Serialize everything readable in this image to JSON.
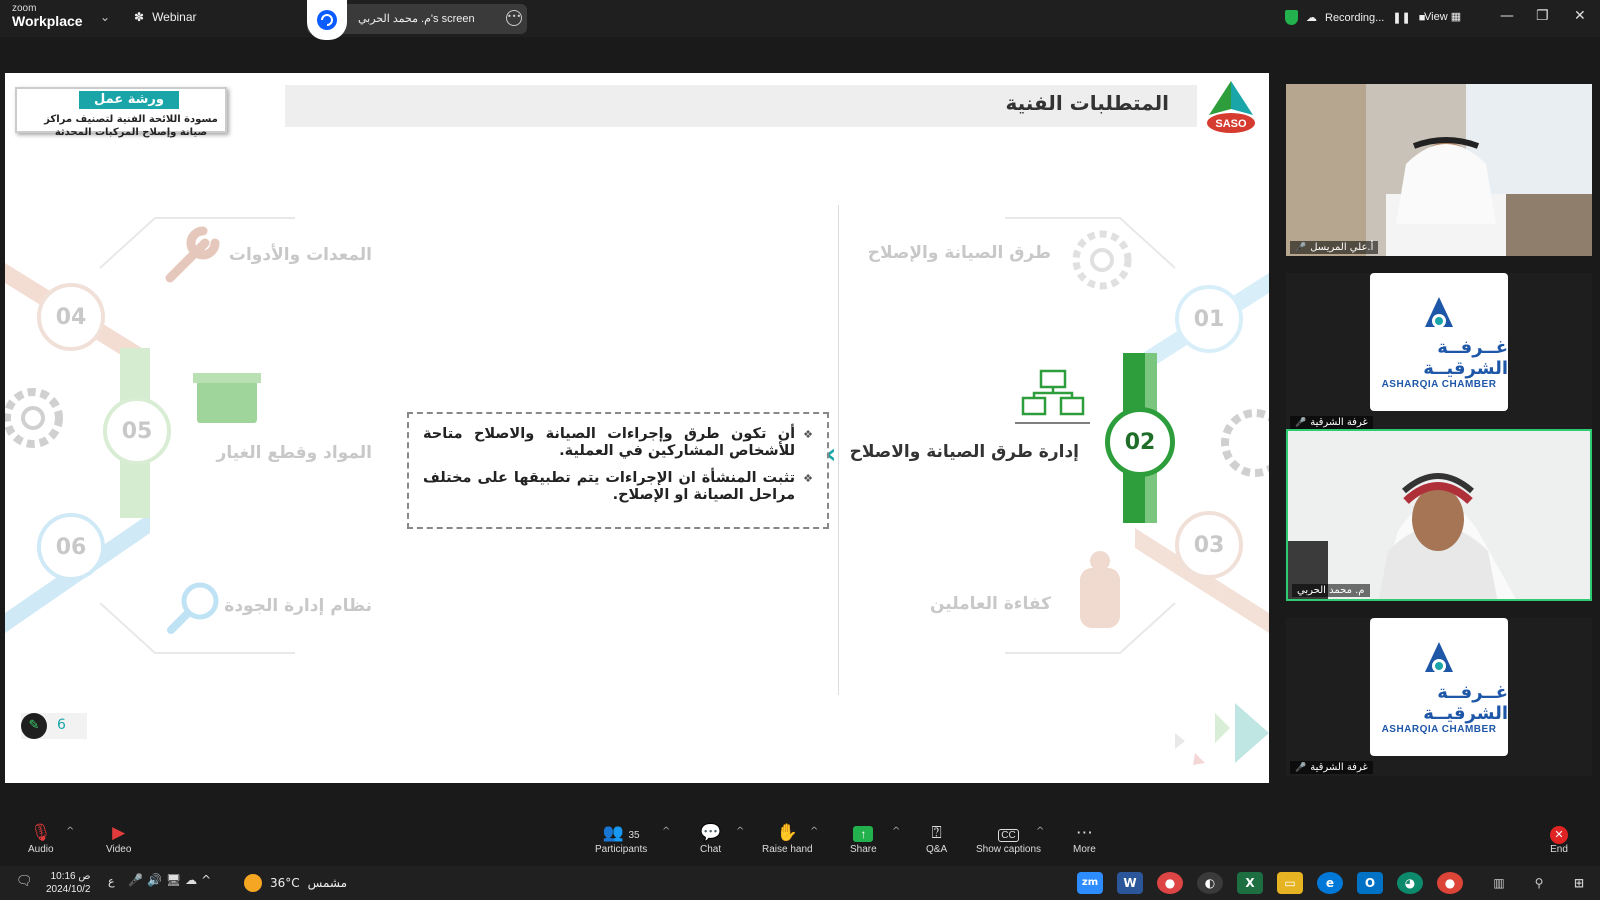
{
  "window": {
    "brand_small": "zoom",
    "brand_big": "Workplace",
    "mode_label": "Webinar",
    "share_label": "م. محمد الحربي's screen",
    "recording_label": "Recording...",
    "view_label": "View"
  },
  "slide": {
    "workshop_tag": "ورشة عمل",
    "workshop_text": "مسودة اللائحة الفنية لتصنيف مراكز صيانة وإصلاح المركبات المحدثة",
    "title": "المتطلبات الفنية",
    "logo_text": "SASO",
    "items": [
      {
        "num": "01",
        "label": "طرق الصيانة والإصلاح"
      },
      {
        "num": "02",
        "label": "إدارة طرق الصيانة والاصلاح"
      },
      {
        "num": "03",
        "label": "كفاءة العاملين"
      },
      {
        "num": "04",
        "label": "المعدات والأدوات"
      },
      {
        "num": "05",
        "label": "المواد وقطع الغيار"
      },
      {
        "num": "06",
        "label": "نظام إدارة الجودة"
      }
    ],
    "bullets": [
      "أن تكون طرق وإجراءات الصيانة والاصلاح متاحة للأشخاص المشاركين في العملية.",
      "تثبت المنشأة ان الإجراءات يتم تطبيقها على مختلف مراحل الصيانة او الإصلاح."
    ],
    "page_number": "6"
  },
  "participants": [
    {
      "name": "أ.علي المريسل",
      "type": "video"
    },
    {
      "name": "غرفة الشرقية",
      "type": "logo"
    },
    {
      "name": "م. محمد الحربي",
      "type": "video",
      "active": true
    },
    {
      "name": "غرفة الشرقية",
      "type": "logo"
    }
  ],
  "chamber_logo": {
    "ar": "غــرفــة الشرقيــة",
    "en": "ASHARQIA CHAMBER"
  },
  "toolbar": {
    "audio": "Audio",
    "video": "Video",
    "participants": "Participants",
    "participants_count": "35",
    "chat": "Chat",
    "raise_hand": "Raise hand",
    "share": "Share",
    "qa": "Q&A",
    "captions": "Show captions",
    "more": "More",
    "end": "End"
  },
  "taskbar": {
    "time": "10:16 ص",
    "date": "2024/10/2",
    "lang": "ع",
    "temperature": "36°C",
    "weather": "مشمس",
    "zoom_icon": "zm"
  },
  "colors": {
    "accent_teal": "#1aa5a8",
    "active_green": "#2e9e3c",
    "chamber_blue": "#1f57a8"
  }
}
